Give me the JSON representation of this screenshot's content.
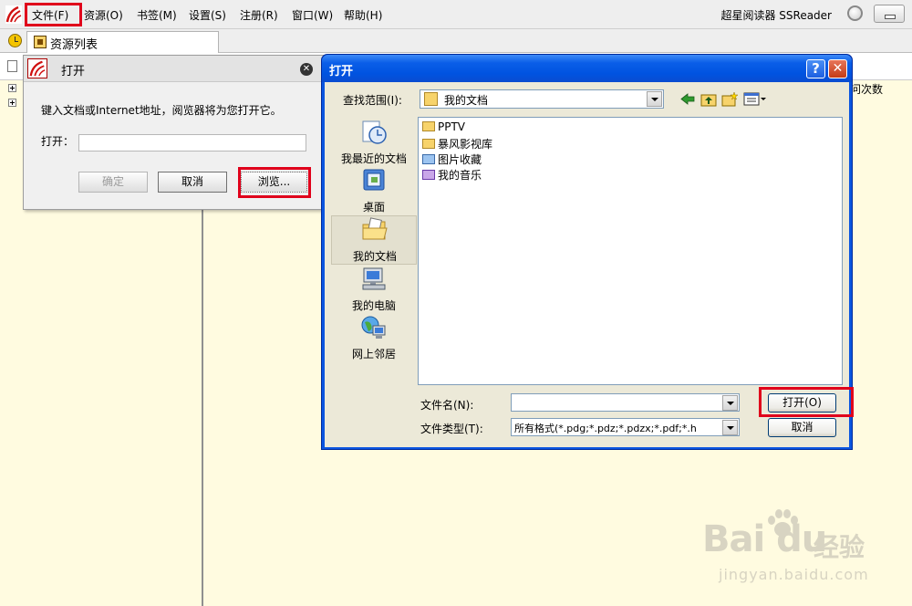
{
  "menubar": {
    "items": [
      "文件(F)",
      "资源(O)",
      "书签(M)",
      "设置(S)",
      "注册(R)",
      "窗口(W)",
      "帮助(H)"
    ],
    "app_title": "超星阅读器 SSReader"
  },
  "tab": {
    "label": "资源列表"
  },
  "column_header": "问次数",
  "small_dialog": {
    "title": "打开",
    "prompt": "键入文档或Internet地址，阅览器将为您打开它。",
    "open_label": "打开：",
    "open_value": "",
    "ok": "确定",
    "cancel": "取消",
    "browse": "浏览..."
  },
  "file_dialog": {
    "title": "打开",
    "help": "?",
    "close": "✕",
    "look_in_label": "查找范围(I):",
    "look_in_value": "我的文档",
    "places": [
      "我最近的文档",
      "桌面",
      "我的文档",
      "我的电脑",
      "网上邻居"
    ],
    "files": [
      "PPTV",
      "暴风影视库",
      "图片收藏",
      "我的音乐"
    ],
    "file_name_label": "文件名(N):",
    "file_name_value": "",
    "file_type_label": "文件类型(T):",
    "file_type_value": "所有格式(*.pdg;*.pdz;*.pdzx;*.pdf;*.h",
    "open_button": "打开(O)",
    "cancel_button": "取消"
  },
  "watermark": {
    "logo": "Bai du",
    "cn": "经验",
    "url": "jingyan.baidu.com"
  },
  "colors": {
    "highlight": "#e0001b",
    "xp_blue": "#0a55e0",
    "dialog_face": "#ece9d8",
    "app_bg": "#fffbe0"
  },
  "icons": [
    "superstar-logo-icon",
    "clock-icon",
    "resource-list-icon",
    "close-icon",
    "help-icon",
    "folder-icon",
    "back-icon",
    "up-folder-icon",
    "new-folder-icon",
    "view-menu-icon"
  ]
}
